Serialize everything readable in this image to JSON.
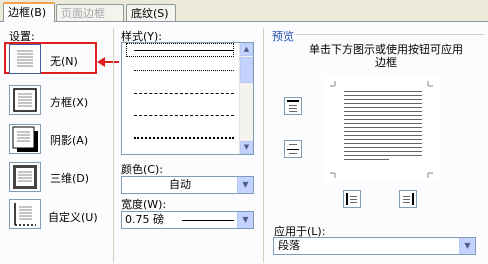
{
  "tabs": [
    {
      "label": "边框(B)"
    },
    {
      "label": "页面边框(P)"
    },
    {
      "label": "底纹(S)"
    }
  ],
  "setting": {
    "label": "设置:",
    "options": [
      {
        "label": "无(N)"
      },
      {
        "label": "方框(X)"
      },
      {
        "label": "阴影(A)"
      },
      {
        "label": "三维(D)"
      },
      {
        "label": "自定义(U)"
      }
    ]
  },
  "style": {
    "label": "样式(Y):",
    "lines": [
      "solid",
      "dotted",
      "dashed",
      "dashed",
      "dash-dot",
      "dash-dot-dot"
    ]
  },
  "color": {
    "label": "颜色(C):",
    "value": "自动"
  },
  "width": {
    "label": "宽度(W):",
    "value": "0.75 磅"
  },
  "preview": {
    "title": "预览",
    "hint": "单击下方图示或使用按钮可应用边框"
  },
  "apply_to": {
    "label": "应用于(L):",
    "value": "段落"
  }
}
